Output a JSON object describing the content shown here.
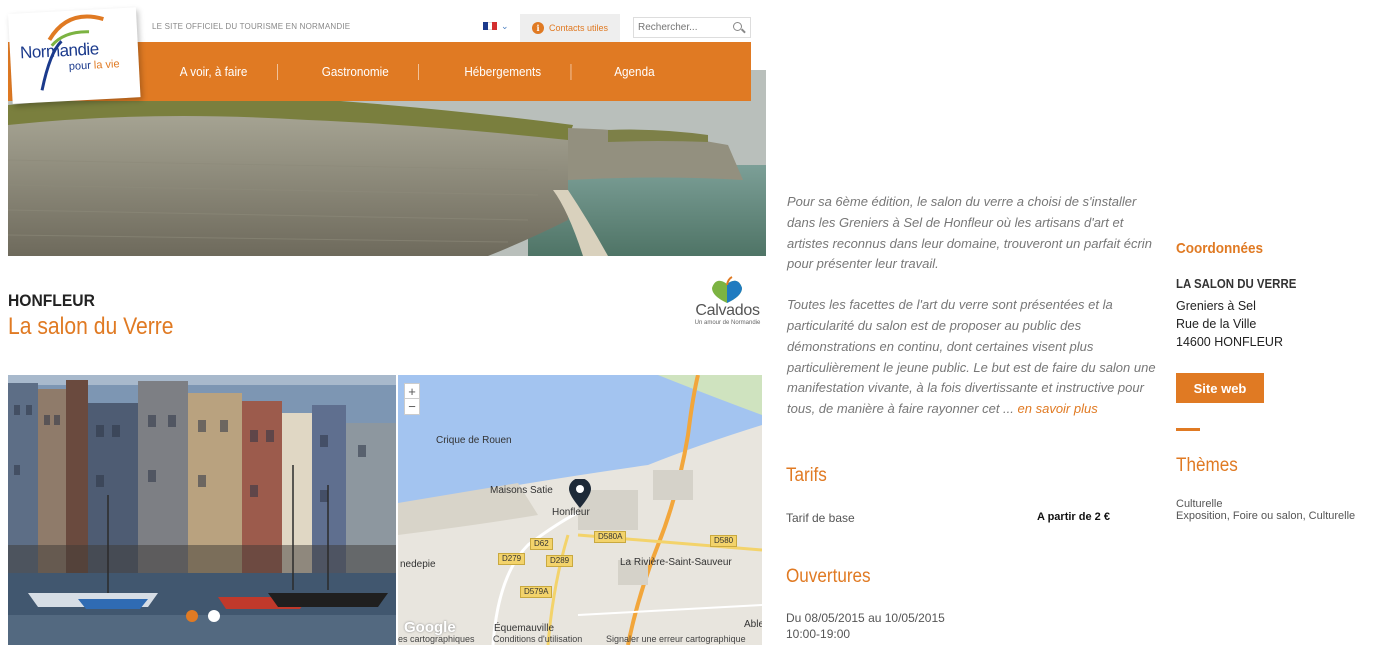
{
  "header": {
    "logo_main": "Normandie",
    "logo_sub_1": "pour ",
    "logo_sub_2": "la vie",
    "tagline": "LE SITE OFFICIEL DU TOURISME EN NORMANDIE",
    "language_flag": "french-flag",
    "contacts_label": "Contacts utiles",
    "search_placeholder": "Rechercher..."
  },
  "nav": {
    "items": [
      "A voir, à faire",
      "Gastronomie",
      "Hébergements",
      "Agenda"
    ]
  },
  "page": {
    "city": "HONFLEUR",
    "event_title": "La salon du Verre",
    "partner_logo_word": "Calvados",
    "partner_logo_sub": "Un amour de Normandie"
  },
  "carousel": {
    "slides": 2,
    "active_index": 0
  },
  "map": {
    "labels": {
      "crique": "Crique de Rouen",
      "maisons": "Maisons Satie",
      "honfleur": "Honfleur",
      "riviere": "La Rivière-Saint-Sauveur",
      "equemauville": "Équemauville",
      "nedepie": "nedepie",
      "able": "Able"
    },
    "roads": [
      "D62",
      "D580A",
      "D580",
      "D279",
      "D289",
      "D579A"
    ],
    "zoom_in": "+",
    "zoom_out": "−",
    "brand": "Google",
    "footer_1": "es cartographiques",
    "footer_2": "Conditions d'utilisation",
    "footer_3": "Signaler une erreur cartographique"
  },
  "description": {
    "p1": "Pour sa 6ème édition, le salon du verre a choisi de s'installer dans les Greniers à Sel de Honfleur où les artisans d'art et artistes reconnus dans leur domaine, trouveront un parfait écrin pour présenter leur travail.",
    "p2": "Toutes les facettes de l'art du verre sont présentées et la particularité du salon est de proposer au public des démonstrations en continu, dont certaines visent plus particulièrement le jeune public. Le but est de faire du salon une manifestation vivante, à la fois divertissante et instructive pour tous, de manière à faire rayonner cet ... ",
    "more": "en savoir plus"
  },
  "tarifs": {
    "title": "Tarifs",
    "label": "Tarif de base",
    "value": "A partir de 2 €"
  },
  "ouvertures": {
    "title": "Ouvertures",
    "dates": "Du 08/05/2015 au 10/05/2015",
    "hours": "10:00-19:00"
  },
  "coordonnees": {
    "title": "Coordonnées",
    "name": "LA SALON DU VERRE",
    "line1": "Greniers à Sel",
    "line2": "Rue de la Ville",
    "line3": "14600 HONFLEUR",
    "button": "Site web"
  },
  "themes": {
    "title": "Thèmes",
    "line1": "Culturelle",
    "line2": "Exposition, Foire ou salon, Culturelle"
  },
  "colors": {
    "accent": "#e07a23",
    "logo_blue": "#1b3a8c"
  }
}
